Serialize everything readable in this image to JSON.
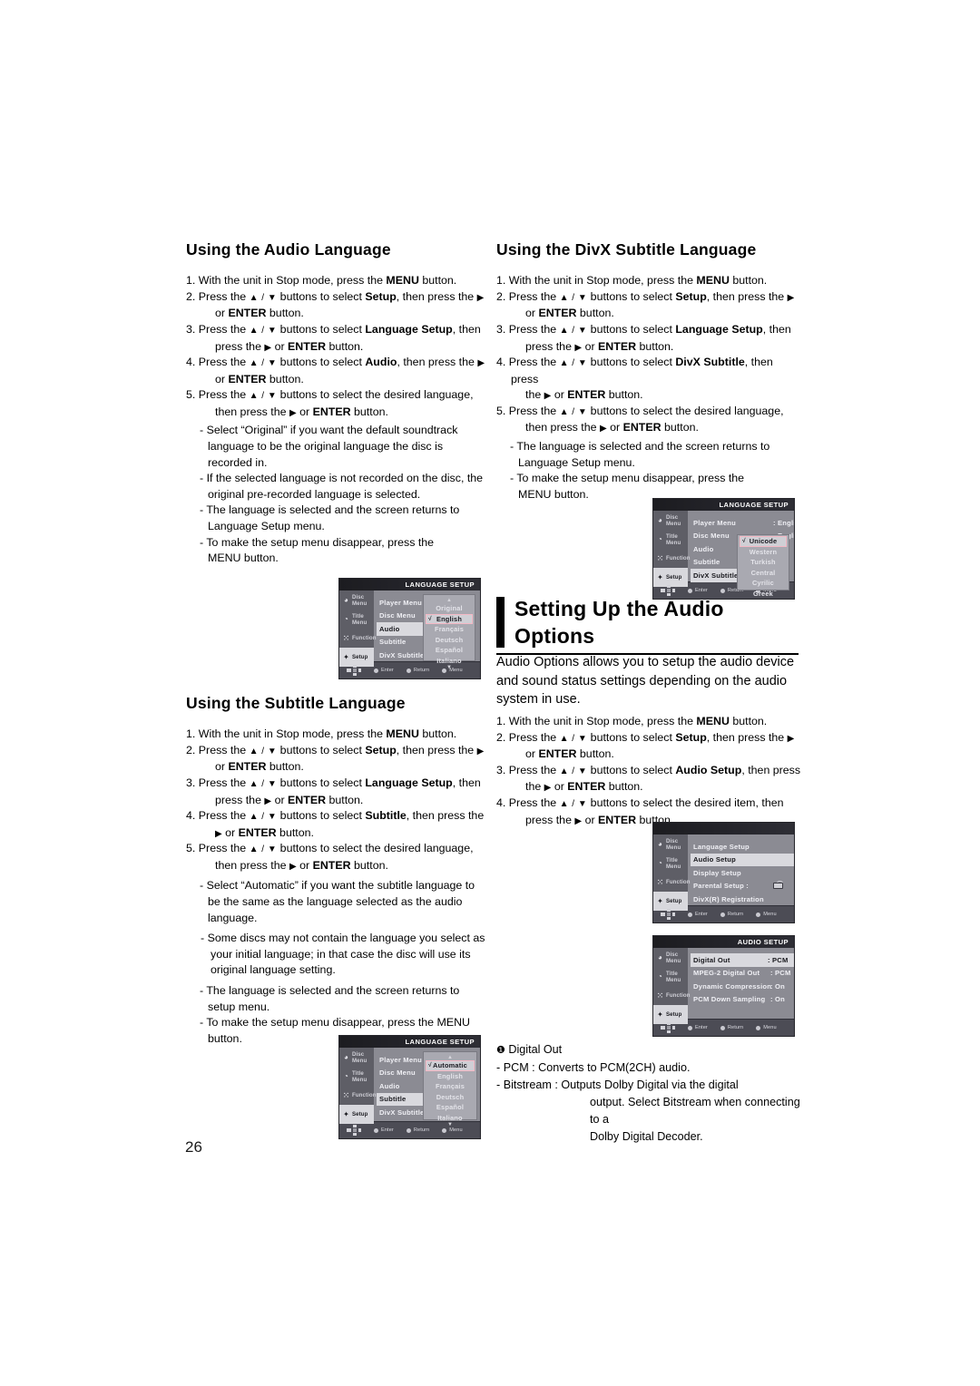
{
  "page": {
    "number": "26"
  },
  "sections": {
    "audio_language": {
      "heading": "Using the Audio Language",
      "steps": [
        {
          "n": "1.",
          "pre": "With the unit in Stop mode, press the ",
          "b1": "MENU",
          "post": " button."
        },
        {
          "n": "2.",
          "pre": "Press the ",
          "b1": "Setup",
          "post": ", then press the "
        },
        {
          "n": "3.",
          "pre": "Press the ",
          "b1": "Language Setup",
          "post": ", then"
        },
        {
          "n": "4.",
          "pre": "Press the ",
          "b1": "Audio",
          "post": ", then press the "
        },
        {
          "n": "5.",
          "pre": "Press the ",
          "b1": "",
          "post": ""
        }
      ],
      "lines": [
        "1. With the unit in Stop mode, press the MENU button.",
        "2. Press the ▲ / ▼ buttons to select Setup, then press the ▶ or ENTER button.",
        "3. Press the ▲ / ▼ buttons to select Language Setup, then press the ▶ or ENTER button.",
        "4. Press the ▲ / ▼ buttons to select Audio, then press the ▶ or ENTER button.",
        "5. Press the ▲ / ▼ buttons to select the desired language, then press the ▶ or ENTER button."
      ],
      "bullets": [
        "Select “Original” if you want the default soundtrack language to be the original language the disc is recorded in.",
        "If the selected language is not recorded on the disc, the original pre-recorded language is selected.",
        "The language is selected and the screen returns to Language Setup menu.",
        "To make the setup menu disappear, press the MENU button."
      ]
    },
    "subtitle_language": {
      "heading": "Using the Subtitle Language",
      "bullets": [
        "Select “Automatic” if you want the subtitle  language to be the same as the language selected as the audio language.",
        "Some discs may not contain the language you select as your initial language; in that case the disc will use its original language setting.",
        "The language is selected and the screen returns to setup menu.",
        "To make the setup menu disappear, press the MENU button."
      ]
    },
    "divx_subtitle_language": {
      "heading": "Using the DivX Subtitle Language",
      "bullets": [
        "The language is selected and the screen returns to Language Setup menu.",
        "To make the setup menu disappear, press the MENU button."
      ]
    },
    "audio_options": {
      "heading_line1": "Setting Up the Audio",
      "heading_line2": "Options",
      "intro": "Audio Options allows you to setup the audio device and sound status settings depending on the audio system in use."
    }
  },
  "common": {
    "step1": {
      "num": "1.",
      "t1": "With the unit in Stop mode, press the ",
      "b": "MENU",
      "t2": " button."
    },
    "step2": {
      "num": "2.",
      "t1": "Press the ",
      "ud": "▲ / ▼",
      "t2": " buttons to select ",
      "b": "Setup",
      "t3": ", then press the ",
      "ar": "▶",
      "l2a": "or ",
      "l2b": "ENTER",
      "l2c": " button."
    },
    "step3_lang": {
      "num": "3.",
      "t1": "Press the ",
      "ud": "▲ / ▼",
      "t2": " buttons to select ",
      "b": "Language Setup",
      "t3": ", then",
      "l2a": "press the ",
      "ar": "▶",
      "l2b": " or ",
      "l2c": "ENTER",
      "l2d": " button."
    },
    "step5_lang": {
      "num": "5.",
      "t1": "Press the ",
      "ud": "▲ / ▼",
      "t2": " buttons to select the desired language,",
      "l2a": "then press the ",
      "ar": "▶",
      "l2b": " or ",
      "l2c": "ENTER",
      "l2d": " button."
    },
    "step5_lang_sp": {
      "num": "5.",
      "t1": "Press the ",
      "ud": "▲ / ▼",
      "t2": " buttons to select the desired  language,",
      "l2a": "then press the ",
      "ar": "▶",
      "l2b": " or ",
      "l2c": "ENTER",
      "l2d": " button."
    }
  },
  "audio_steps": {
    "step4": {
      "num": "4.",
      "t1": "Press the ",
      "ud": "▲ / ▼",
      "t2": " buttons to select ",
      "b": "Audio",
      "t3": ", then press the ",
      "ar": "▶",
      "l2a": "or ",
      "l2b": "ENTER",
      "l2c": " button."
    }
  },
  "subtitle_steps": {
    "step4": {
      "num": "4.",
      "t1": "Press the ",
      "ud": "▲ / ▼",
      "t2": " buttons to select ",
      "b": "Subtitle",
      "t3": ", then press the ",
      "ar": "▶",
      "l2b": " or ",
      "l2c": "ENTER",
      "l2d": " button."
    }
  },
  "divx_steps": {
    "step4": {
      "num": "4.",
      "t1": "Press the ",
      "ud": "▲ / ▼",
      "t2": " buttons to select ",
      "b": "DivX Subtitle",
      "t3": ", then press",
      "l2a": "the ",
      "ar": "▶",
      "l2b": " or ",
      "l2c": "ENTER",
      "l2d": " button."
    }
  },
  "audio_opt_steps": {
    "step3": {
      "num": "3.",
      "t1": "Press the ",
      "ud": "▲ / ▼",
      "t2": " buttons to select ",
      "b": "Audio Setup",
      "t3": ", then press",
      "l2a": "the ",
      "ar": "▶",
      "l2b": " or ",
      "l2c": "ENTER",
      "l2d": " button."
    },
    "step4": {
      "num": "4.",
      "t1": "Press the ",
      "ud": "▲ / ▼",
      "t2": " buttons to select the desired item, then",
      "l2a": "press the ",
      "ar": "▶",
      "l2b": " or ",
      "l2c": "ENTER",
      "l2d": " button."
    }
  },
  "bullets": {
    "audio": [
      {
        "dash": "-",
        "l": [
          "Select “Original” if you want the default soundtrack",
          "language to be the original language the disc is",
          "recorded in."
        ]
      },
      {
        "dash": "-",
        "l": [
          "If the selected language is not recorded on the disc, the",
          "original pre-recorded language is selected."
        ]
      },
      {
        "dash": "-",
        "l": [
          "The language is selected and the screen returns to",
          "Language Setup menu."
        ]
      },
      {
        "dash": "-",
        "l": [
          "To make the setup menu disappear, press the",
          "MENU button."
        ]
      }
    ],
    "subtitle": [
      {
        "dash": "-",
        "l": [
          "Select “Automatic” if you want the subtitle  language to",
          "be the same as the language selected as the audio",
          "language."
        ]
      },
      {
        "dash": "-",
        "l": [
          " Some discs may not contain the language you select as",
          " your initial language; in that case the disc will use its",
          " original language setting."
        ]
      },
      {
        "dash": "-",
        "l": [
          "The language is selected and the screen returns to",
          "setup menu."
        ]
      },
      {
        "dash": "-",
        "l": [
          "To make the setup menu disappear, press the MENU",
          "button."
        ]
      }
    ],
    "divx": [
      {
        "dash": "-",
        "l": [
          "The language is selected and the screen returns to",
          "Language Setup menu."
        ]
      },
      {
        "dash": "-",
        "l": [
          "To make the setup menu disappear, press the",
          "MENU button."
        ]
      }
    ]
  },
  "osd": {
    "rail": [
      {
        "label": "Disc Menu",
        "icon": "disc-menu-icon"
      },
      {
        "label": "Title Menu",
        "icon": "title-menu-icon"
      },
      {
        "label": "Function",
        "icon": "function-icon"
      },
      {
        "label": "Setup",
        "icon": "setup-icon"
      }
    ],
    "footer": [
      {
        "label": "Enter"
      },
      {
        "label": "Return"
      },
      {
        "label": "Menu"
      }
    ],
    "language_setup_title": "LANGUAGE SETUP",
    "audio_setup_title": "AUDIO SETUP",
    "language_rows": [
      "Player Menu",
      "Disc Menu",
      "Audio",
      "Subtitle",
      "DivX Subtitle"
    ],
    "audio_screen": {
      "selected_row": "Audio",
      "dropdown": [
        "Original",
        "English",
        "Français",
        "Deutsch",
        "Español",
        "Italiano"
      ],
      "current": "English",
      "up_arrow": "▲",
      "down_arrow": "▼",
      "check": "√"
    },
    "subtitle_screen": {
      "selected_row": "Subtitle",
      "dropdown": [
        "Automatic",
        "English",
        "Français",
        "Deutsch",
        "Español",
        "Italiano"
      ],
      "current": "Automatic",
      "check": "√"
    },
    "divx_screen": {
      "selected_row": "DivX Subtitle",
      "values": [
        {
          "label": "Player Menu",
          "value": ": English"
        },
        {
          "label": "Disc Menu",
          "value": ": English"
        },
        {
          "label": "Audio",
          "value": ""
        },
        {
          "label": "Subtitle",
          "value": ""
        },
        {
          "label": "DivX Subtitle",
          "value": ""
        }
      ],
      "dropdown": [
        "Unicode",
        "Western",
        "Turkish",
        "Central",
        "Cyrilic",
        "Greek"
      ],
      "current": "Unicode",
      "check": "√"
    },
    "setup_menu": {
      "rows": [
        {
          "label": "Language Setup",
          "value": "",
          "chev": "▶",
          "sel": false
        },
        {
          "label": "Audio Setup",
          "value": "",
          "chev": "▶",
          "sel": true
        },
        {
          "label": "Display Setup",
          "value": "",
          "chev": "▶",
          "sel": false
        },
        {
          "label": "Parental Setup :",
          "value": "",
          "chev": "▶",
          "sel": false,
          "lock": true
        },
        {
          "label": "DivX(R) Registration",
          "value": "",
          "chev": "▶",
          "sel": false
        }
      ]
    },
    "audio_setup": {
      "rows": [
        {
          "label": "Digital Out",
          "value": ": PCM",
          "sel": true
        },
        {
          "label": "MPEG-2 Digital Out",
          "value": ":  PCM",
          "sel": false
        },
        {
          "label": "Dynamic Compression",
          "value": ": On",
          "sel": false
        },
        {
          "label": "PCM Down Sampling",
          "value": ":  On",
          "sel": false
        }
      ]
    }
  },
  "note": {
    "marker": "❶",
    "title": "Digital Out",
    "line1": "- PCM : Converts to PCM(2CH) audio.",
    "line2": "- Bitstream : Outputs Dolby Digital via the digital",
    "line3": "output. Select Bitstream when connecting to a",
    "line4": "Dolby Digital Decoder."
  }
}
